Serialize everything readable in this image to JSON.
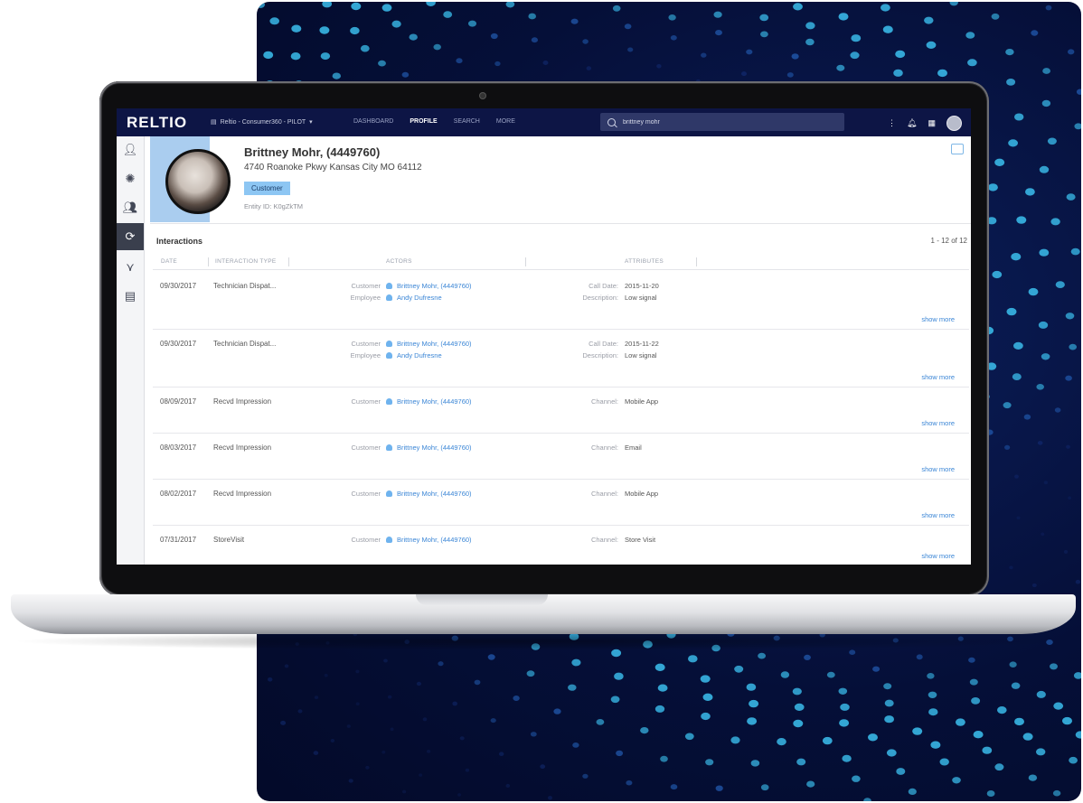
{
  "app": {
    "logo": "RELTIO",
    "tenant": "Reltio - Consumer360 - PILOT",
    "nav": [
      "DASHBOARD",
      "PROFILE",
      "SEARCH",
      "MORE"
    ],
    "nav_active": "PROFILE",
    "search_value": "brittney mohr",
    "accent": "#3b86d6",
    "topbar_color": "#0d1545"
  },
  "icons": {
    "rail": [
      "person-icon",
      "network-icon",
      "people-icon",
      "interactions-icon",
      "hierarchy-icon",
      "table-icon"
    ],
    "top": [
      "more-vert-icon",
      "bell-icon",
      "grid-icon",
      "user-avatar"
    ]
  },
  "profile": {
    "name": "Brittney Mohr, (4449760)",
    "address": "4740 Roanoke Pkwy Kansas City MO 64112",
    "badge": "Customer",
    "entity_id": "Entity ID: K0gZkTM"
  },
  "interactions": {
    "title": "Interactions",
    "pager": "1 - 12 of 12",
    "columns": [
      "DATE",
      "INTERACTION TYPE",
      "ACTORS",
      "ATTRIBUTES"
    ],
    "show_more": "show more",
    "rows": [
      {
        "date": "09/30/2017",
        "type": "Technician Dispat...",
        "actors": [
          {
            "role": "Customer",
            "name": "Brittney Mohr, (4449760)"
          },
          {
            "role": "Employee",
            "name": "Andy Dufresne"
          }
        ],
        "attrs": [
          {
            "k": "Call Date",
            "v": "2015-11-20"
          },
          {
            "k": "Description",
            "v": "Low signal"
          }
        ]
      },
      {
        "date": "09/30/2017",
        "type": "Technician Dispat...",
        "actors": [
          {
            "role": "Customer",
            "name": "Brittney Mohr, (4449760)"
          },
          {
            "role": "Employee",
            "name": "Andy Dufresne"
          }
        ],
        "attrs": [
          {
            "k": "Call Date",
            "v": "2015-11-22"
          },
          {
            "k": "Description",
            "v": "Low signal"
          }
        ]
      },
      {
        "date": "08/09/2017",
        "type": "Recvd Impression",
        "actors": [
          {
            "role": "Customer",
            "name": "Brittney Mohr, (4449760)"
          }
        ],
        "attrs": [
          {
            "k": "Channel",
            "v": "Mobile App"
          }
        ]
      },
      {
        "date": "08/03/2017",
        "type": "Recvd Impression",
        "actors": [
          {
            "role": "Customer",
            "name": "Brittney Mohr, (4449760)"
          }
        ],
        "attrs": [
          {
            "k": "Channel",
            "v": "Email"
          }
        ]
      },
      {
        "date": "08/02/2017",
        "type": "Recvd Impression",
        "actors": [
          {
            "role": "Customer",
            "name": "Brittney Mohr, (4449760)"
          }
        ],
        "attrs": [
          {
            "k": "Channel",
            "v": "Mobile App"
          }
        ]
      },
      {
        "date": "07/31/2017",
        "type": "StoreVisit",
        "actors": [
          {
            "role": "Customer",
            "name": "Brittney Mohr, (4449760)"
          }
        ],
        "attrs": [
          {
            "k": "Channel",
            "v": "Store Visit"
          }
        ]
      }
    ]
  }
}
